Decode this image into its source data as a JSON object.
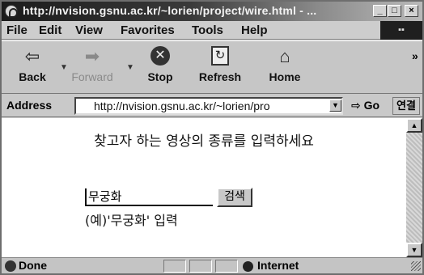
{
  "window": {
    "title": "http://nvision.gsnu.ac.kr/~lorien/project/wire.html - ..."
  },
  "menu": {
    "items": [
      "File",
      "Edit",
      "View",
      "Favorites",
      "Tools",
      "Help"
    ]
  },
  "toolbar": {
    "back": "Back",
    "forward": "Forward",
    "stop": "Stop",
    "refresh": "Refresh",
    "home": "Home"
  },
  "address": {
    "label": "Address",
    "url": "http://nvision.gsnu.ac.kr/~lorien/pro",
    "go": "Go",
    "links": "연결"
  },
  "page": {
    "heading": "찾고자 하는 영상의 종류를 입력하세요",
    "search_value": "무궁화",
    "search_button": "검색",
    "example": "(예)'무궁화' 입력"
  },
  "status": {
    "text": "Done",
    "zone": "Internet"
  }
}
